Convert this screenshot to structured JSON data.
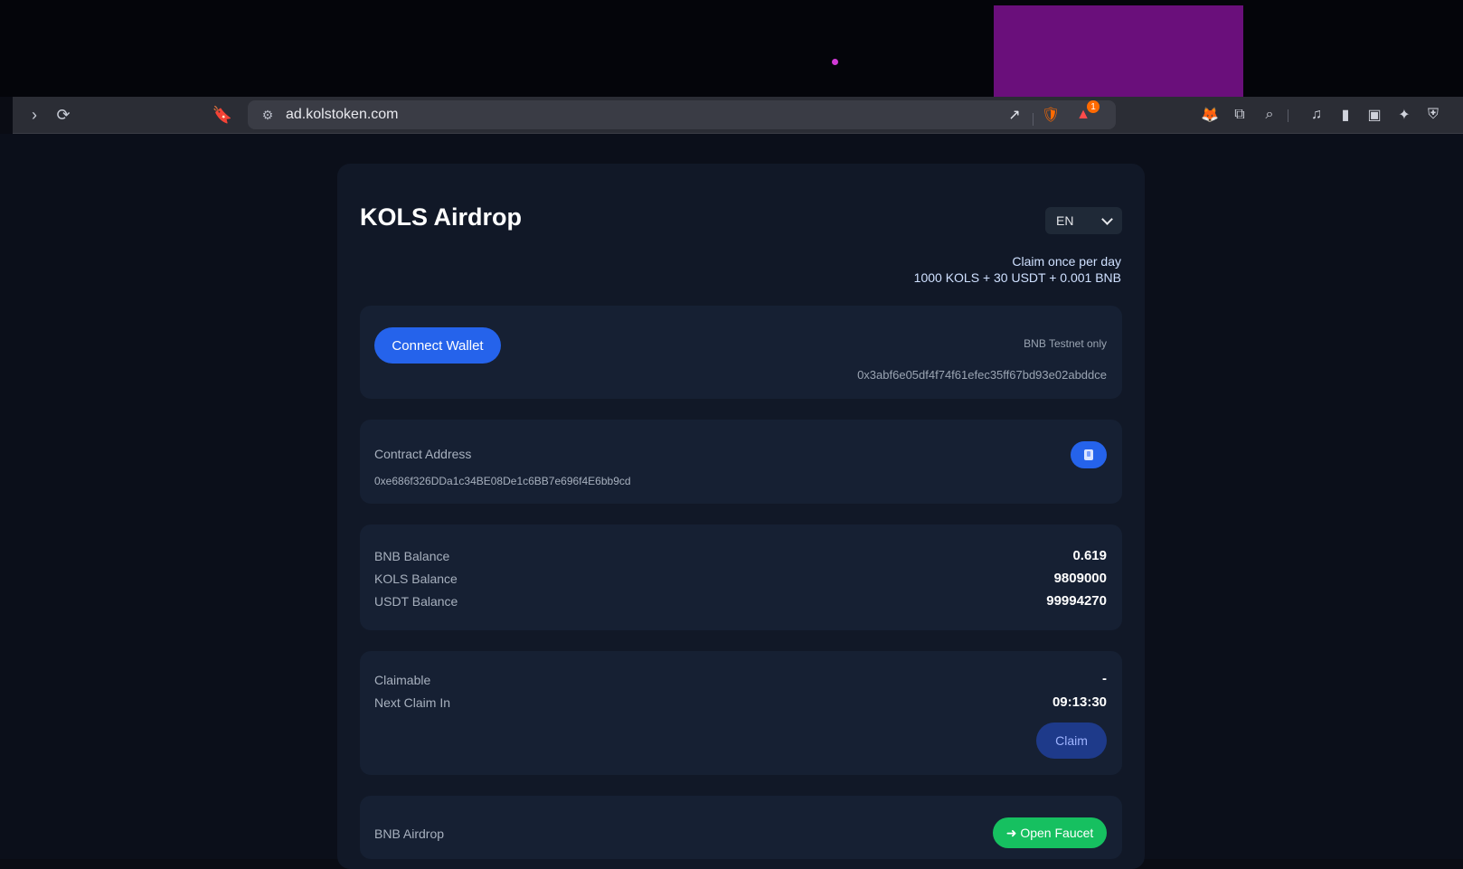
{
  "browser": {
    "url": "ad.kolstoken.com",
    "notification_count": "1"
  },
  "app": {
    "title": "KOLS Airdrop",
    "language": "EN",
    "hint_line1": "Claim once per day",
    "hint_line2": "1000 KOLS + 30 USDT + 0.001 BNB"
  },
  "wallet": {
    "connect_label": "Connect Wallet",
    "network_note": "BNB Testnet only",
    "address": "0x3abf6e05df4f74f61efec35ff67bd93e02abddce"
  },
  "contract": {
    "label": "Contract Address",
    "address": "0xe686f326DDa1c34BE08De1c6BB7e696f4E6bb9cd"
  },
  "balances": [
    {
      "label": "BNB Balance",
      "value": "0.619"
    },
    {
      "label": "KOLS Balance",
      "value": "9809000"
    },
    {
      "label": "USDT Balance",
      "value": "99994270"
    }
  ],
  "claim": {
    "claimable_label": "Claimable",
    "claimable_value": "-",
    "next_claim_label": "Next Claim In",
    "next_claim_value": "09:13:30",
    "claim_button": "Claim"
  },
  "faucet": {
    "label": "BNB Airdrop",
    "button": "➜ Open Faucet"
  },
  "colors": {
    "accent": "#2563eb",
    "success": "#16c060",
    "card_bg": "#111827"
  },
  "icons": {
    "forward": "forward-icon",
    "reload": "reload-icon",
    "bookmark": "bookmark-icon",
    "site-settings": "tune-icon",
    "share": "share-icon",
    "brave": "brave-shield-icon",
    "rewards": "brave-rewards-icon",
    "extensions": "extensions-icon",
    "tab-search": "tab-search-icon",
    "media": "music-icon",
    "sidebar": "sidebar-icon",
    "wallet": "wallet-icon",
    "leo": "leo-ai-icon",
    "vpn": "vpn-shield-icon",
    "copy": "copy-icon"
  }
}
